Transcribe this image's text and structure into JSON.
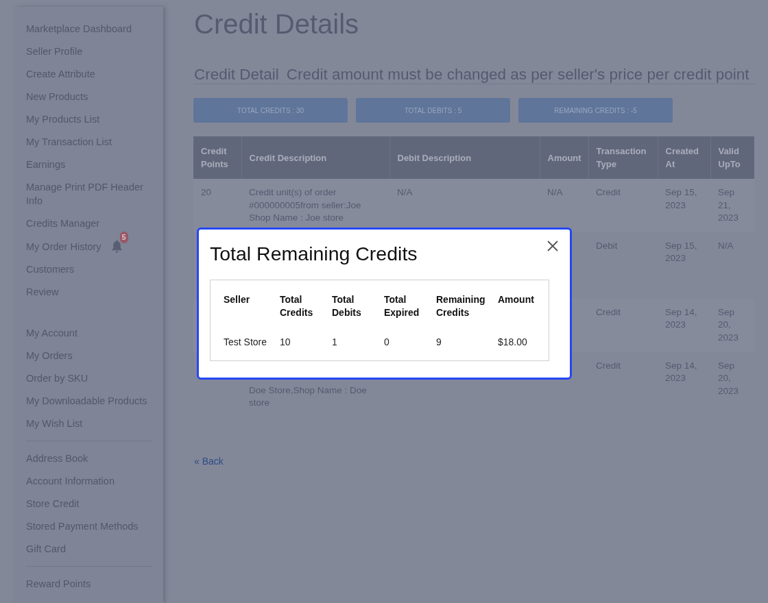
{
  "sidebar": {
    "seller_menu": [
      {
        "label": "Marketplace Dashboard"
      },
      {
        "label": "Seller Profile"
      },
      {
        "label": "Create Attribute"
      },
      {
        "label": "New Products"
      },
      {
        "label": "My Products List"
      },
      {
        "label": "My Transaction List"
      },
      {
        "label": "Earnings"
      },
      {
        "label": "Manage Print PDF Header Info"
      },
      {
        "label": "Credits Manager"
      },
      {
        "label": "My Order History",
        "badge": "5"
      },
      {
        "label": "Customers"
      },
      {
        "label": "Review"
      }
    ],
    "account_menu": [
      [
        "My Account",
        "My Orders",
        "Order by SKU",
        "My Downloadable Products",
        "My Wish List"
      ],
      [
        "Address Book",
        "Account Information",
        "Store Credit",
        "Stored Payment Methods",
        "Gift Card"
      ],
      [
        "Reward Points"
      ]
    ]
  },
  "page": {
    "title": "Credit Details",
    "section": {
      "title": "Credit Detail",
      "note": "Credit amount must be changed as per seller's price per credit point"
    }
  },
  "summary_buttons": [
    "TOTAL CREDITS : 30",
    "TOTAL DEBITS : 5",
    "REMAINING CREDITS : -5"
  ],
  "credit_table": {
    "columns": [
      "Credit Points",
      "Credit Description",
      "Debit Description",
      "Amount",
      "Transaction Type",
      "Created At",
      "Valid UpTo"
    ],
    "rows": [
      {
        "credit_points": "20",
        "credit_description": "Credit unit(s) of order #000000005from seller:Joe Shop Name : Joe store",
        "debit_description": "N/A",
        "amount": "N/A",
        "transaction_type": "Credit",
        "created_at": "Sep 15, 2023",
        "valid_upto": "Sep 21, 2023"
      },
      {
        "transaction_type": "Debit",
        "created_at": "Sep 15, 2023",
        "valid_upto": "N/A"
      },
      {
        "transaction_type": "Credit",
        "created_at": "Sep 14, 2023",
        "valid_upto": "Sep 20, 2023"
      },
      {
        "credit_description": "Doe Store,Shop Name : Doe store",
        "transaction_type": "Credit",
        "created_at": "Sep 14, 2023",
        "valid_upto": "Sep 20, 2023"
      }
    ]
  },
  "back_link": "« Back",
  "modal": {
    "title": "Total Remaining Credits",
    "table": {
      "columns": [
        "Seller",
        "Total Credits",
        "Total Debits",
        "Total Expired",
        "Remaining Credits",
        "Amount"
      ],
      "rows": [
        [
          "Test Store",
          "10",
          "1",
          "0",
          "9",
          "$18.00"
        ]
      ]
    }
  }
}
